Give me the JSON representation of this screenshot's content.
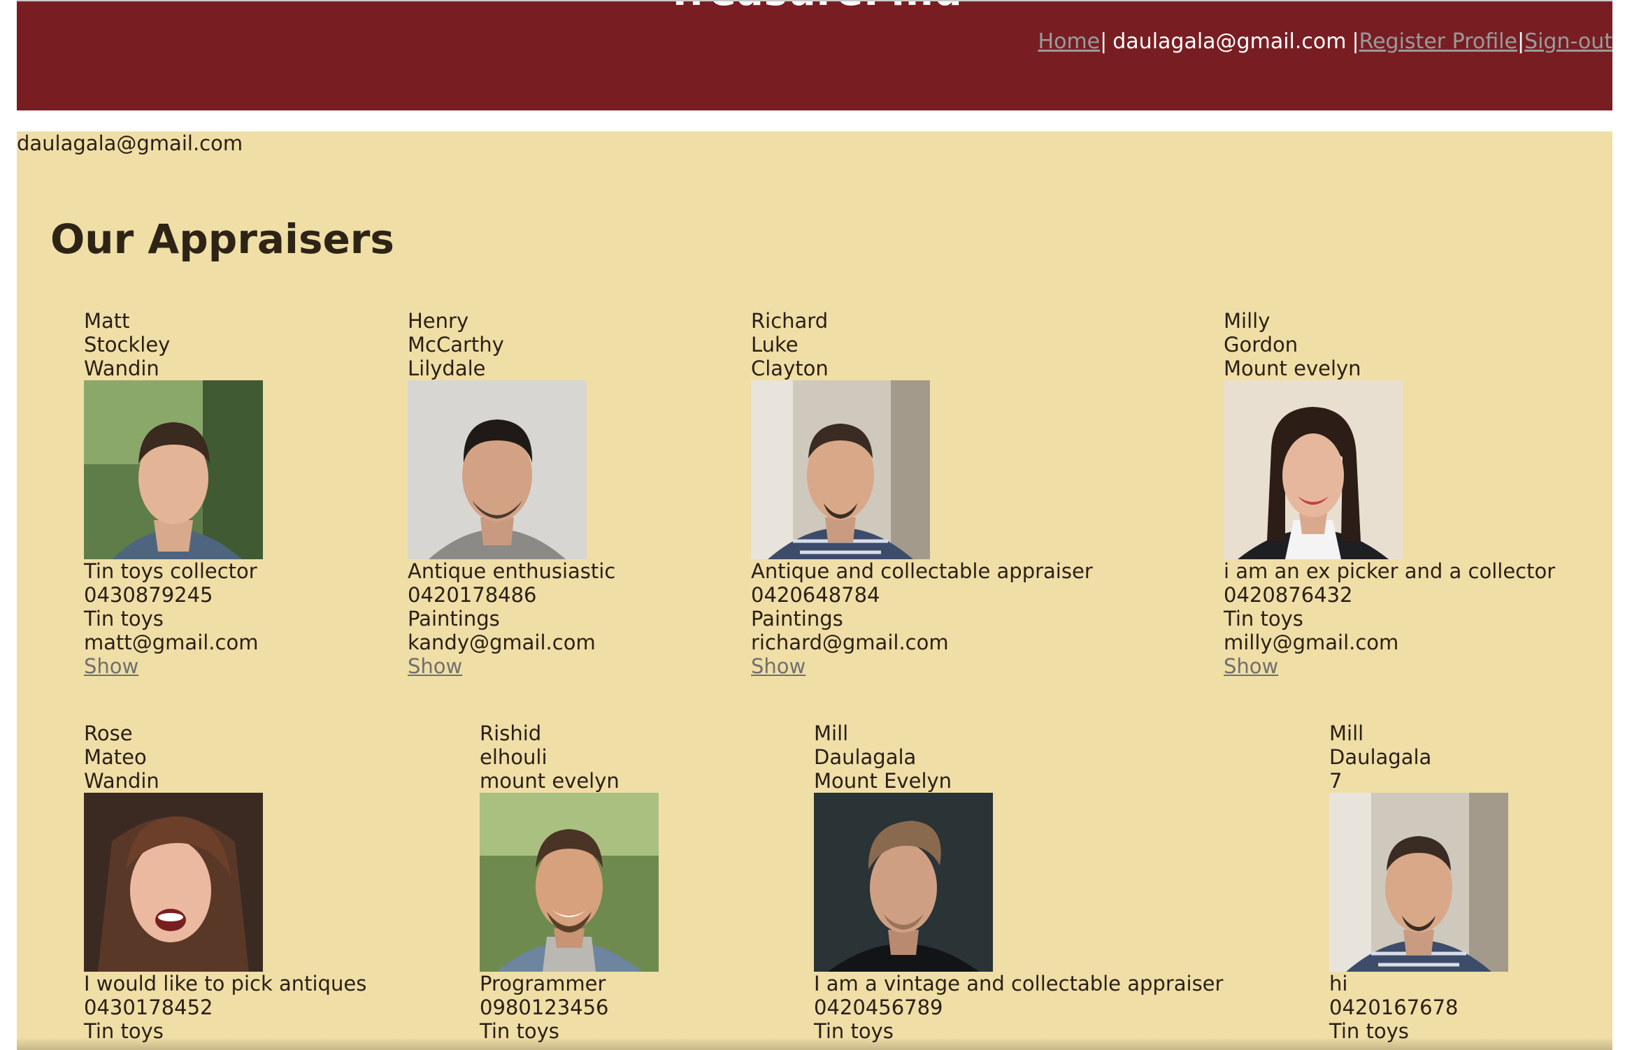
{
  "header": {
    "site_title": "TreasureFind",
    "nav": {
      "home": "Home",
      "user": "daulagala@gmail.com",
      "register": "Register Profile",
      "signout": "Sign-out",
      "separator": "|"
    }
  },
  "user_email": "daulagala@gmail.com",
  "page_title": "Our Appraisers",
  "appraisers": [
    {
      "first": "Matt",
      "last": "Stockley",
      "location": "Wandin",
      "bio": "Tin toys collector",
      "phone": "0430879245",
      "specialty": "Tin toys",
      "email": "matt@gmail.com",
      "action": "Show"
    },
    {
      "first": "Henry",
      "last": "McCarthy",
      "location": "Lilydale",
      "bio": "Antique enthusiastic",
      "phone": "0420178486",
      "specialty": "Paintings",
      "email": "kandy@gmail.com",
      "action": "Show"
    },
    {
      "first": "Richard",
      "last": "Luke",
      "location": "Clayton",
      "bio": "Antique and collectable appraiser",
      "phone": "0420648784",
      "specialty": "Paintings",
      "email": "richard@gmail.com",
      "action": "Show"
    },
    {
      "first": "Milly",
      "last": "Gordon",
      "location": "Mount evelyn",
      "bio": "i am an ex picker and a collector",
      "phone": "0420876432",
      "specialty": "Tin toys",
      "email": "milly@gmail.com",
      "action": "Show"
    },
    {
      "first": "Rose",
      "last": "Mateo",
      "location": "Wandin",
      "bio": "I would like to pick antiques",
      "phone": "0430178452",
      "specialty": "Tin toys"
    },
    {
      "first": "Rishid",
      "last": "elhouli",
      "location": "mount evelyn",
      "bio": "Programmer",
      "phone": "0980123456",
      "specialty": "Tin toys"
    },
    {
      "first": "Mill",
      "last": "Daulagala",
      "location": "Mount Evelyn",
      "bio": "I am a vintage and collectable appraiser",
      "phone": "0420456789",
      "specialty": "Tin toys"
    },
    {
      "first": "Mill",
      "last": "Daulagala",
      "location": "7",
      "bio": "hi",
      "phone": "0420167678",
      "specialty": "Tin toys"
    }
  ],
  "colors": {
    "header_bg": "#781e23",
    "content_bg": "#f0dea7",
    "link_gray": "#707070"
  }
}
